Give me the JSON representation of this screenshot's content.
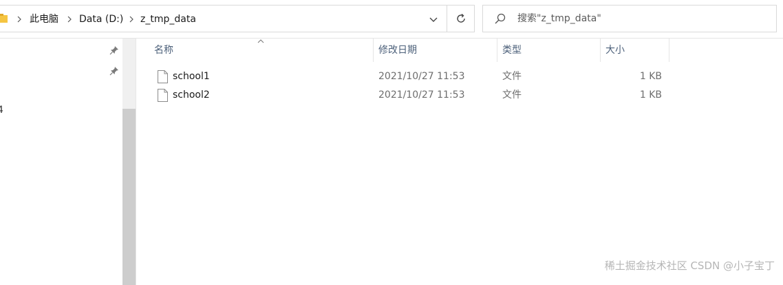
{
  "address_bar": {
    "breadcrumbs": [
      "此电脑",
      "Data (D:)",
      "z_tmp_data"
    ]
  },
  "search": {
    "placeholder": "搜索\"z_tmp_data\""
  },
  "nav_pane": {
    "partial_text": "4"
  },
  "file_list": {
    "columns": [
      "名称",
      "修改日期",
      "类型",
      "大小"
    ],
    "rows": [
      {
        "name": "school1",
        "modified": "2021/10/27 11:53",
        "type": "文件",
        "size": "1 KB"
      },
      {
        "name": "school2",
        "modified": "2021/10/27 11:53",
        "type": "文件",
        "size": "1 KB"
      }
    ]
  },
  "watermark": "稀土掘金技术社区 CSDN @小子宝丁",
  "icons": {
    "folder": "folder-icon",
    "separator": "chevron-right-icon",
    "dropdown": "chevron-down-icon",
    "refresh": "refresh-icon",
    "search": "search-icon",
    "pin": "pin-icon",
    "file": "file-icon",
    "sort": "sort-up-icon"
  },
  "colors": {
    "header_text": "#4c607a",
    "folder_yellow": "#f5c542",
    "scroll_thumb": "#cdcdcd"
  }
}
